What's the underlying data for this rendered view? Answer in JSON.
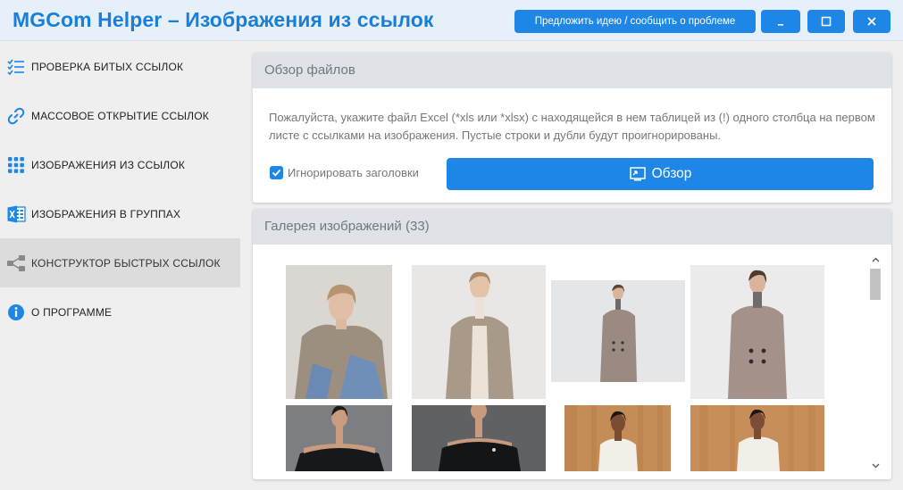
{
  "app": {
    "title": "MGCom Helper – Изображения из ссылок"
  },
  "titlebar": {
    "idea_button": "Предложить идею / сообщить о проблеме",
    "minimize_icon": "minimize-icon",
    "maximize_icon": "maximize-icon",
    "close_icon": "close-icon"
  },
  "colors": {
    "accent": "#1e86e6",
    "title": "#1a7fd8",
    "panel_header": "#dfe2e6",
    "active_nav": "#dcdcdc"
  },
  "sidebar": {
    "items": [
      {
        "label": "ПРОВЕРКА БИТЫХ ССЫЛОК",
        "icon": "checklist-icon",
        "active": false
      },
      {
        "label": "МАССОВОЕ ОТКРЫТИЕ ССЫЛОК",
        "icon": "link-icon",
        "active": false
      },
      {
        "label": "ИЗОБРАЖЕНИЯ ИЗ ССЫЛОК",
        "icon": "grid-dots-icon",
        "active": false
      },
      {
        "label": "ИЗОБРАЖЕНИЯ В ГРУППАХ",
        "icon": "excel-icon",
        "active": false
      },
      {
        "label": "КОНСТРУКТОР БЫСТРЫХ ССЫЛОК",
        "icon": "share-nodes-icon",
        "active": true
      },
      {
        "label": "О ПРОГРАММЕ",
        "icon": "info-icon",
        "active": false
      }
    ]
  },
  "files_panel": {
    "header": "Обзор файлов",
    "description": "Пожалуйста, укажите файл Excel (*xls или *xlsx) с находящейся в нем таблицей из (!) одного столбца на первом листе с ссылками на изображения. Пустые строки и дубли будут проигнорированы.",
    "ignore_headers_label": "Игнорировать заголовки",
    "ignore_headers_checked": true,
    "browse_label": "Обзор",
    "browse_icon": "monitor-cast-icon"
  },
  "gallery_panel": {
    "header": "Галерея изображений (33)",
    "thumbnails": [
      {
        "name": "photo-woman-beige-blazer-sitting",
        "bg": "#d8d4cf"
      },
      {
        "name": "photo-woman-beige-blazer-standing",
        "bg": "#e7e6e4"
      },
      {
        "name": "photo-woman-check-suit",
        "bg": "#e3e4e6"
      },
      {
        "name": "photo-woman-check-blazer",
        "bg": "#e9e9ea"
      },
      {
        "name": "photo-woman-black-offshoulder-1",
        "bg": "#7d7f83"
      },
      {
        "name": "photo-woman-black-offshoulder-2",
        "bg": "#5f6165"
      },
      {
        "name": "photo-woman-white-vest-1",
        "bg": "#c58d58"
      },
      {
        "name": "photo-woman-white-vest-2",
        "bg": "#c98f5a"
      }
    ]
  }
}
